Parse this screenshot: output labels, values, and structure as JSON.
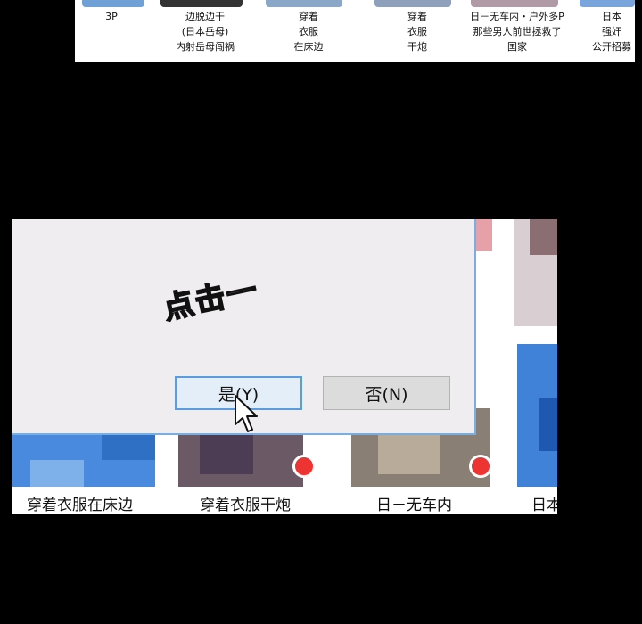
{
  "top_strip": {
    "captions": [
      {
        "lines": [
          "3P"
        ]
      },
      {
        "lines": [
          "边脱边干",
          "(日本岳母)",
          "内射岳母闯祸"
        ]
      },
      {
        "lines": [
          "穿着",
          "衣服",
          "在床边"
        ]
      },
      {
        "lines": [
          "穿着",
          "衣服",
          "干炮"
        ]
      },
      {
        "lines": [
          "日－无车内・户外多P",
          "那些男人前世拯救了",
          "国家"
        ]
      },
      {
        "lines": [
          "日本",
          "强奸",
          "公开招募"
        ]
      }
    ]
  },
  "dialog": {
    "sound_effect": "点击一",
    "yes_button": "是(Y)",
    "no_button": "否(N)"
  },
  "bottom_labels": [
    "穿着衣服在床边",
    "穿着衣服干炮",
    "日－无车内",
    "日本"
  ],
  "colors": {
    "background": "#000000",
    "dialog_bg": "#efedf0",
    "dialog_border": "#7aaee0",
    "yes_border": "#5b9be0",
    "mosaic_blue": "#3f82d8"
  }
}
